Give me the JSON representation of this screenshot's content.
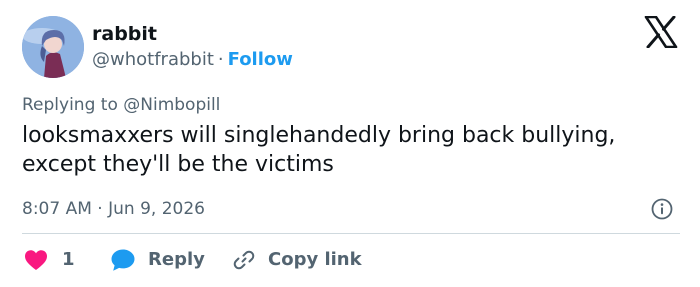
{
  "author": {
    "display_name": "rabbit",
    "handle": "@whotfrabbit",
    "separator": "·",
    "follow_label": "Follow",
    "avatar_icon": "anime-character-avatar"
  },
  "platform_logo": "x-logo-icon",
  "replying_to": {
    "prefix": "Replying to",
    "mention": "@Nimbopill"
  },
  "tweet": {
    "text": "looksmaxxers will singlehandedly bring back bullying, except they'll be the victims",
    "time": "8:07 AM",
    "separator": "·",
    "date": "Jun 9, 2026"
  },
  "actions": {
    "like_count": "1",
    "reply_label": "Reply",
    "copy_link_label": "Copy link"
  },
  "colors": {
    "text_primary": "#0f1419",
    "text_secondary": "#536471",
    "link_blue": "#1d9bf0",
    "like_red": "#f91880",
    "divider": "#cfd9de"
  }
}
